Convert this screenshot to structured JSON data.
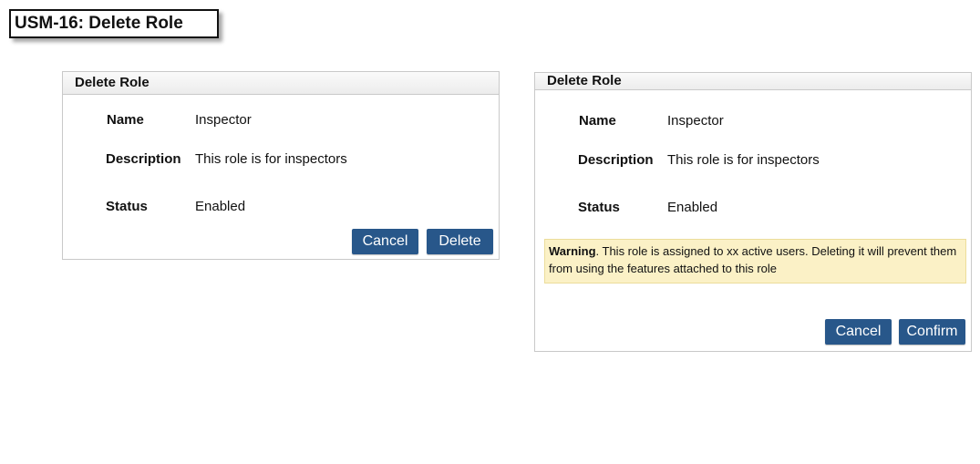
{
  "page_title": "USM-16: Delete Role",
  "dialog_delete": {
    "title": "Delete Role",
    "name_label": "Name",
    "name_value": "Inspector",
    "description_label": "Description",
    "description_value": "This role is for inspectors",
    "status_label": "Status",
    "status_value": "Enabled",
    "cancel_label": "Cancel",
    "delete_label": "Delete"
  },
  "dialog_confirm": {
    "title": "Delete Role",
    "name_label": "Name",
    "name_value": "Inspector",
    "description_label": "Description",
    "description_value": "This role is for inspectors",
    "status_label": "Status",
    "status_value": "Enabled",
    "warning_strong": "Warning",
    "warning_text": ". This role is assigned to xx active users. Deleting it will prevent them from using the features attached to this role",
    "cancel_label": "Cancel",
    "confirm_label": "Confirm"
  },
  "colors": {
    "button_bg": "#28578a",
    "warning_bg": "#fbf1c6"
  }
}
